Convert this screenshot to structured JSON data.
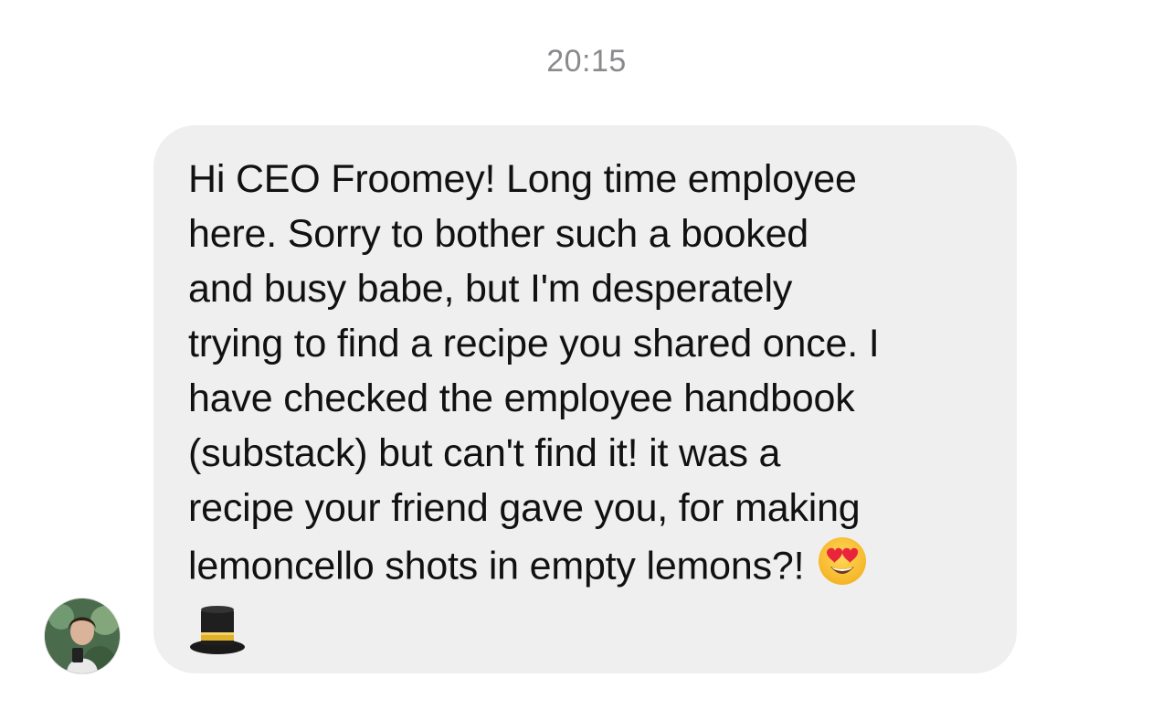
{
  "conversation": {
    "timestamp": "20:15",
    "incoming_message": {
      "lines": [
        "Hi CEO Froomey! Long time employee",
        "here. Sorry to bother such a booked",
        "and busy babe, but I'm desperately",
        "trying to find a recipe you shared once. I",
        "have checked the employee handbook",
        "(substack) but can't find it! it was a",
        "recipe your friend gave you, for making",
        "lemoncello shots in empty lemons?!"
      ],
      "emojis": [
        "heart-eyes-emoji",
        "top-hat-emoji"
      ],
      "bubble_color": "#efefef",
      "text_color": "#111111"
    },
    "sender_avatar": "avatar-photo"
  }
}
